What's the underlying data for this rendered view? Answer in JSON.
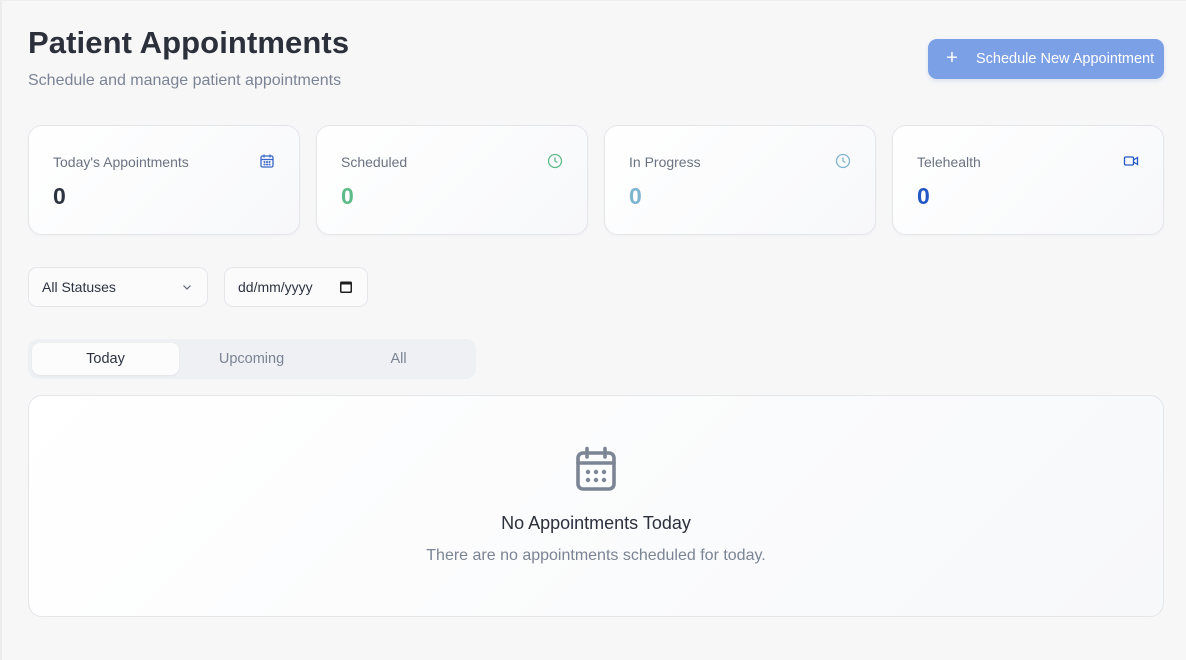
{
  "header": {
    "title": "Patient Appointments",
    "subtitle": "Schedule and manage patient appointments",
    "primary_action": {
      "icon": "plus-icon",
      "label": "Schedule New Appointment"
    }
  },
  "stats": [
    {
      "label": "Today's Appointments",
      "value": "0",
      "icon": "calendar-icon",
      "color": "#2d3340",
      "icon_color": "#3a67c9"
    },
    {
      "label": "Scheduled",
      "value": "0",
      "icon": "clock-icon",
      "color": "#5dbb8a",
      "icon_color": "#5dbb8a"
    },
    {
      "label": "In Progress",
      "value": "0",
      "icon": "clock-icon",
      "color": "#7fb4cf",
      "icon_color": "#7fb4cf"
    },
    {
      "label": "Telehealth",
      "value": "0",
      "icon": "video-icon",
      "color": "#2557c4",
      "icon_color": "#2557c4"
    }
  ],
  "filters": {
    "status_select": {
      "value": "All Statuses"
    },
    "date_input": {
      "placeholder": "dd/mm/yyyy"
    }
  },
  "tabs": [
    {
      "label": "Today",
      "active": true
    },
    {
      "label": "Upcoming",
      "active": false
    },
    {
      "label": "All",
      "active": false
    }
  ],
  "empty_state": {
    "icon": "calendar-icon",
    "title": "No Appointments Today",
    "text": "There are no appointments scheduled for today."
  },
  "colors": {
    "accent": "#7ba0e6",
    "muted_text": "#7b8494",
    "background": "#f7f7f8"
  }
}
